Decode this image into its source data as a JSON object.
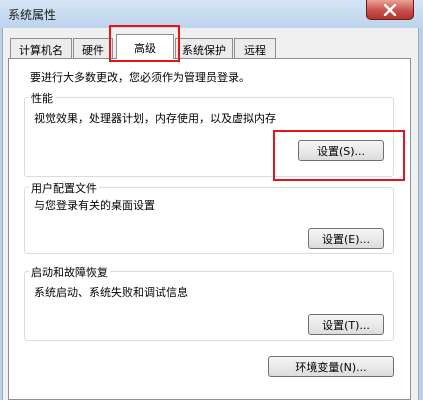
{
  "window": {
    "title": "系统属性",
    "close_symbol": "x"
  },
  "tabs": [
    {
      "label": "计算机名",
      "active": false
    },
    {
      "label": "硬件",
      "active": false
    },
    {
      "label": "高级",
      "active": true
    },
    {
      "label": "系统保护",
      "active": false
    },
    {
      "label": "远程",
      "active": false
    }
  ],
  "advanced": {
    "admin_note": "要进行大多数更改，您必须作为管理员登录。",
    "performance": {
      "title": "性能",
      "description": "视觉效果，处理器计划，内存使用，以及虚拟内存",
      "settings_button": "设置(S)..."
    },
    "user_profiles": {
      "title": "用户配置文件",
      "description": "与您登录有关的桌面设置",
      "settings_button": "设置(E)..."
    },
    "startup_recovery": {
      "title": "启动和故障恢复",
      "description": "系统启动、系统失败和调试信息",
      "settings_button": "设置(T)..."
    },
    "env_vars_button": "环境变量(N)..."
  },
  "highlight_color": "#e5141b"
}
